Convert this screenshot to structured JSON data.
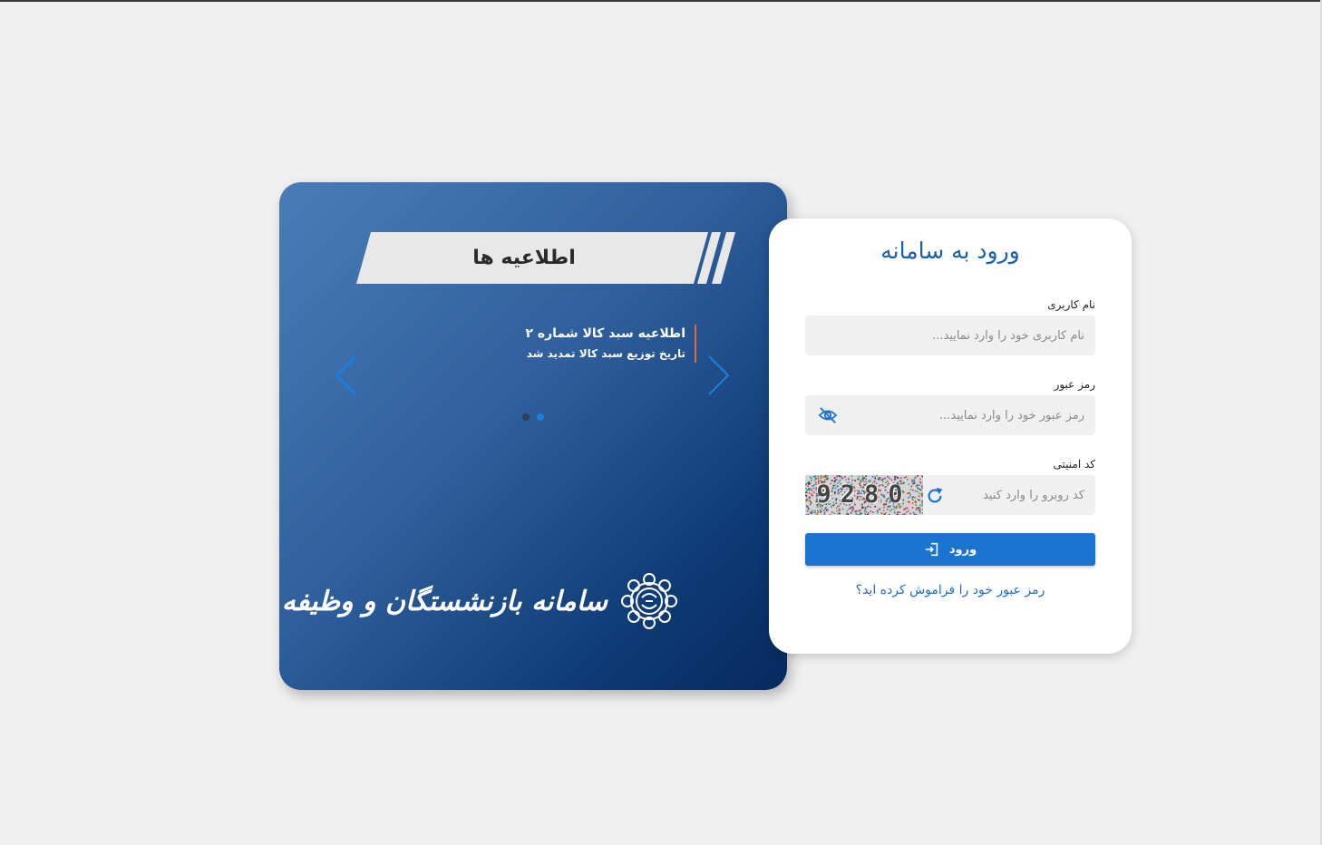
{
  "announcements": {
    "heading": "اطلاعیه ها",
    "items": [
      {
        "title": "اطلاعیه سبد کالا شماره ۲",
        "body": "تاریخ توزیع سبد کالا تمدید شد"
      }
    ],
    "slide_count": 2,
    "active_slide": 2,
    "prev_icon": "chevron-left-icon",
    "next_icon": "chevron-right-icon"
  },
  "brand": {
    "name": "سامانه بازنشستگان و وظیفه بگیران",
    "emblem_icon": "tehran-municipality-emblem"
  },
  "login": {
    "title": "ورود به سامانه",
    "username_label": "نام کاربری",
    "username_placeholder": "نام کاربری خود را وارد نمایید...",
    "password_label": "رمز عبور",
    "password_placeholder": "رمز عبور خود را وارد نمایید...",
    "password_toggle_icon": "eye-off-icon",
    "captcha_label": "کد امنیتی",
    "captcha_placeholder": "کد روبرو را وارد کنید",
    "captcha_code": "9280",
    "refresh_icon": "refresh-icon",
    "submit_label": "ورود",
    "submit_icon": "login-icon",
    "forgot_password": "رمز عبور خود را فراموش کرده اید؟"
  },
  "colors": {
    "primary": "#1b74cf",
    "title_blue": "#1a5fa8",
    "card_gradient_start": "#4a7db8",
    "card_gradient_end": "#072a5e",
    "accent_orange": "#e06a3a",
    "page_background": "#f0f0f0"
  }
}
